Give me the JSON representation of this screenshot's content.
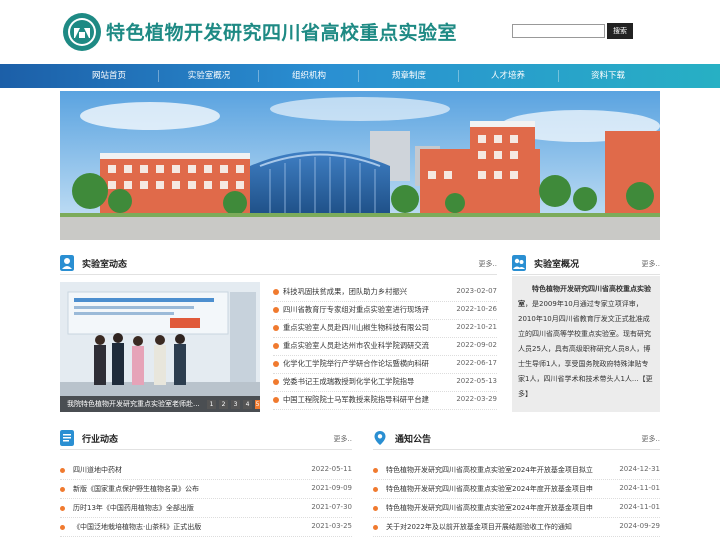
{
  "header": {
    "title": "特色植物开发研究四川省高校重点实验室",
    "search_placeholder": "",
    "search_button": "搜索",
    "colors": {
      "title": "#1e8a84"
    }
  },
  "nav": {
    "items": [
      {
        "label": "网站首页"
      },
      {
        "label": "实验室概况"
      },
      {
        "label": "组织机构"
      },
      {
        "label": "规章制度"
      },
      {
        "label": "人才培养"
      },
      {
        "label": "资料下载"
      }
    ]
  },
  "lab_news": {
    "title": "实验室动态",
    "more": "更多..",
    "slide_caption": "我院特色植物开发研究重点实验室老师赴...",
    "slide_dots": [
      "1",
      "2",
      "3",
      "4",
      "5"
    ],
    "slide_active": 4,
    "items": [
      {
        "text": "科技巩固扶贫成果，团队助力乡村振兴",
        "date": "2023-02-07"
      },
      {
        "text": "四川省教育厅专家组对重点实验室进行现场评",
        "date": "2022-10-26"
      },
      {
        "text": "重点实验室人员赴四川山椒生物科技有限公司",
        "date": "2022-10-21"
      },
      {
        "text": "重点实验室人员赴达州市农业科学院调研交流",
        "date": "2022-09-02"
      },
      {
        "text": "化学化工学院举行产学研合作论坛暨横向科研",
        "date": "2022-06-17"
      },
      {
        "text": "党委书记王成瑞教授到化学化工学院指导",
        "date": "2022-05-13"
      },
      {
        "text": "中国工程院院士马军教授来院指导科研平台建",
        "date": "2022-03-29"
      }
    ]
  },
  "lab_overview": {
    "title": "实验室概况",
    "more": "更多..",
    "name": "特色植物开发研究四川省高校重点实验室",
    "body": "，是2009年10月通过专家立项评审，2010年10月四川省教育厅发文正式批准成立的四川省高等学校重点实验室。现有研究人员25人，具有高级职称研究人员8人，博士生导师1人，享受国务院政府特殊津贴专家1人，四川省学术和技术带头人1人...",
    "more_link": "【更多】"
  },
  "industry_news": {
    "title": "行业动态",
    "more": "更多..",
    "items": [
      {
        "text": "四川道地中药材",
        "date": "2022-05-11"
      },
      {
        "text": "新版《国家重点保护野生植物名录》公布",
        "date": "2021-09-09"
      },
      {
        "text": "历时13年《中国药用植物志》全部出版",
        "date": "2021-07-30"
      },
      {
        "text": "《中国泛地栽培植物志·山茶科》正式出版",
        "date": "2021-03-25"
      }
    ]
  },
  "notices": {
    "title": "通知公告",
    "more": "更多..",
    "items": [
      {
        "text": "特色植物开发研究四川省高校重点实验室2024年开放基金项目拟立",
        "date": "2024-12-31"
      },
      {
        "text": "特色植物开发研究四川省高校重点实验室2024年度开放基金项目申",
        "date": "2024-11-01"
      },
      {
        "text": "特色植物开发研究四川省高校重点实验室2024年度开放基金项目申",
        "date": "2024-11-01"
      },
      {
        "text": "关于对2022年及以前开放基金项目开展结题验收工作的通知",
        "date": "2024-09-29"
      }
    ]
  }
}
